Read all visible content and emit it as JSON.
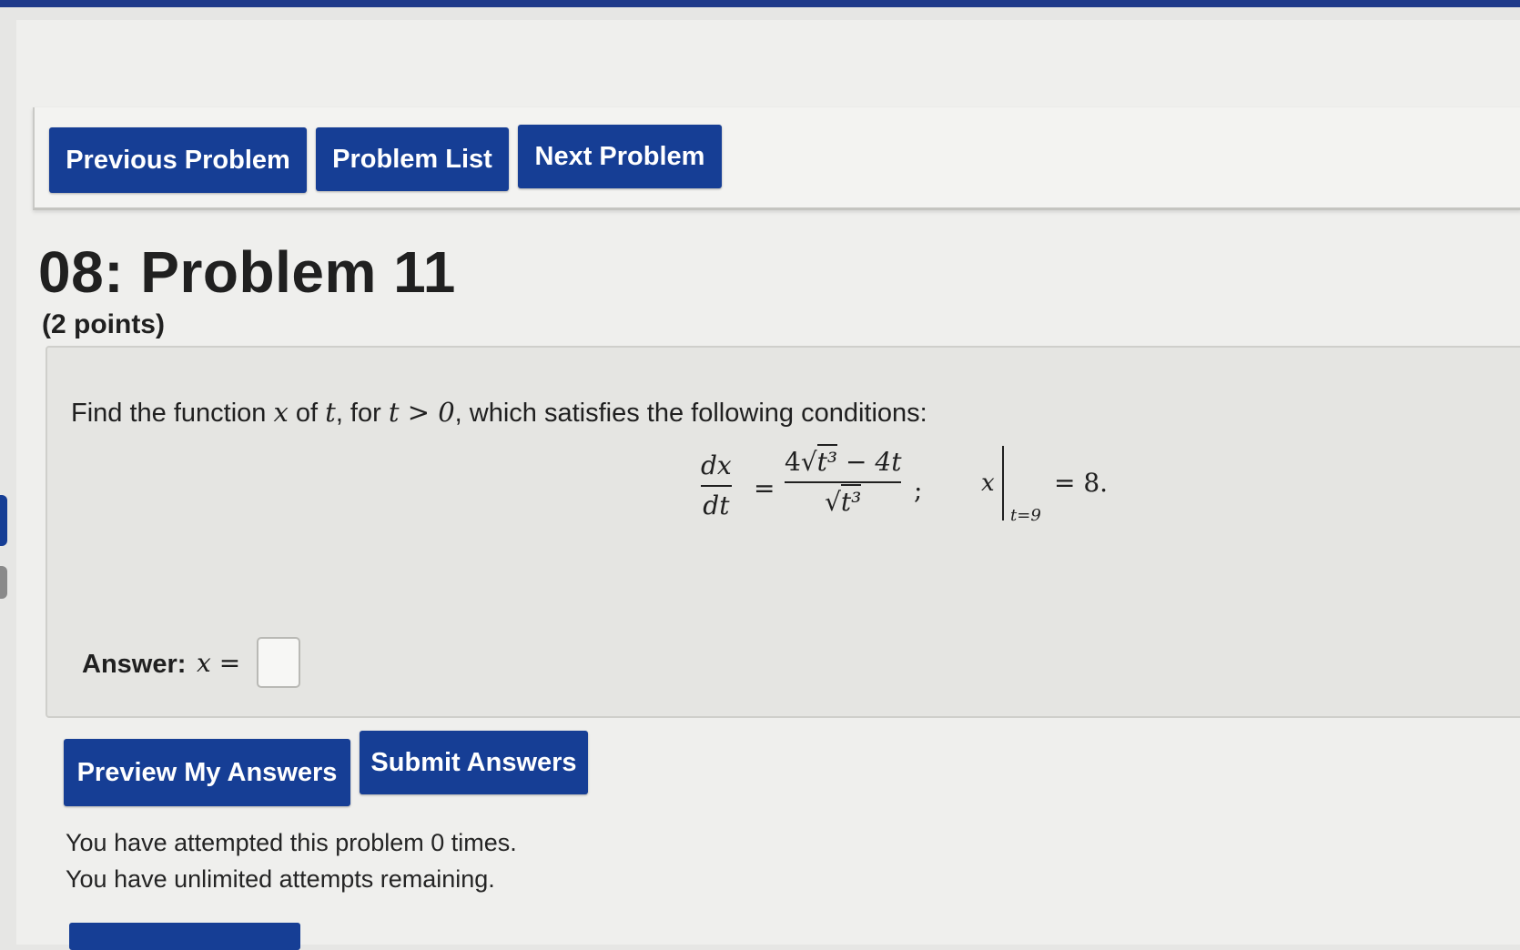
{
  "navigation": {
    "previous_label": "Previous Problem",
    "list_label": "Problem List",
    "next_label": "Next Problem"
  },
  "problem": {
    "title": "08: Problem 11",
    "points": "(2 points)",
    "statement_pre": "Find the function ",
    "statement_var_x": "x",
    "statement_of": " of ",
    "statement_var_t": "t",
    "statement_for": ", for ",
    "statement_condition": "t > 0",
    "statement_post": ", which satisfies the following conditions:",
    "equation": {
      "lhs_num": "dx",
      "lhs_den": "dt",
      "equals": "=",
      "rhs_num_coef": "4",
      "rhs_num_radicand": "t³",
      "rhs_num_tail": " − 4t",
      "rhs_den_radicand": "t³",
      "separator": ";",
      "ic_var": "x",
      "ic_sub": "t=9",
      "ic_value": "= 8."
    }
  },
  "answer": {
    "label": "Answer:",
    "math_prefix": "x =",
    "value": ""
  },
  "actions": {
    "preview_label": "Preview My Answers",
    "submit_label": "Submit Answers"
  },
  "status": {
    "attempts_line": "You have attempted this problem 0 times.",
    "remaining_line": "You have unlimited attempts remaining."
  }
}
